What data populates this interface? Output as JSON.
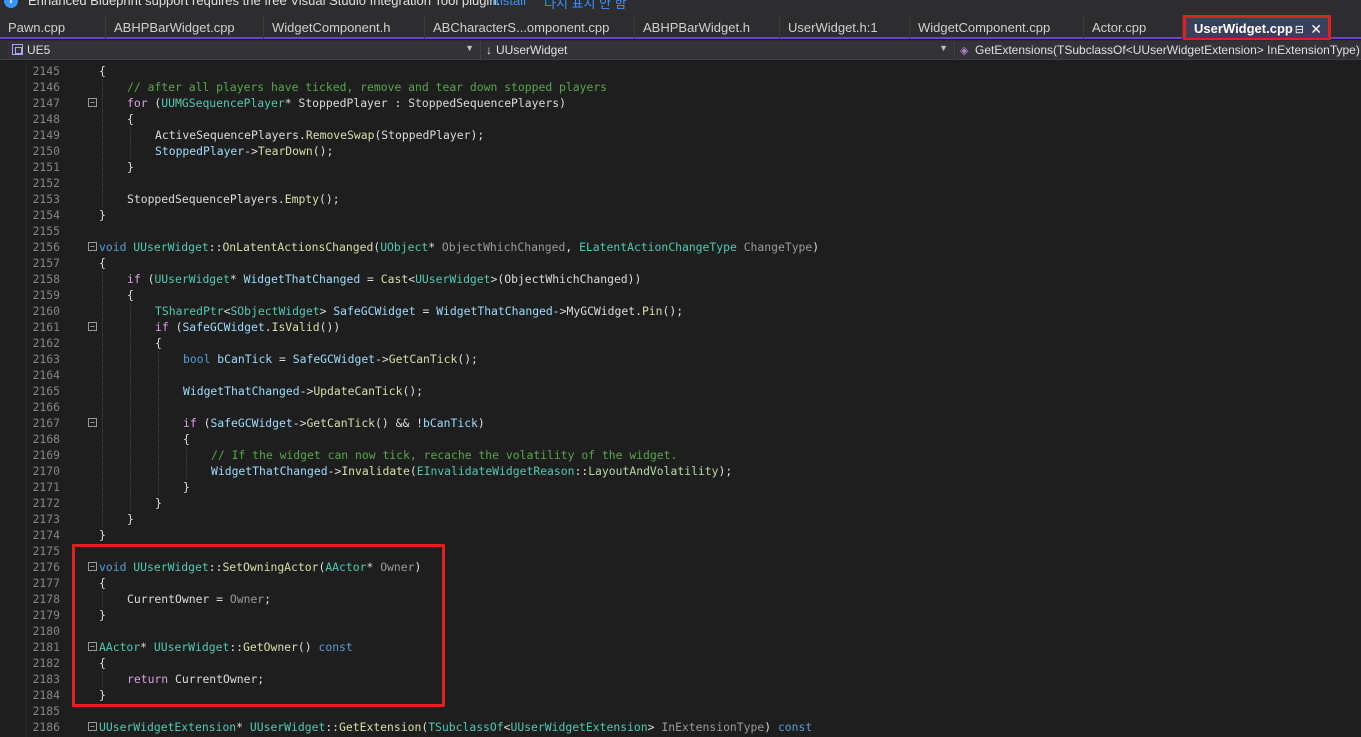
{
  "infobar": {
    "text": "Enhanced Blueprint support requires the free Visual Studio Integration Tool plugin.",
    "link_install": "Install",
    "link_dismiss": "다시 표시 안 함"
  },
  "tabs": [
    {
      "label": "Pawn.cpp",
      "active": false
    },
    {
      "label": "ABHPBarWidget.cpp",
      "active": false
    },
    {
      "label": "WidgetComponent.h",
      "active": false
    },
    {
      "label": "ABCharacterS...omponent.cpp",
      "active": false
    },
    {
      "label": "ABHPBarWidget.h",
      "active": false
    },
    {
      "label": "UserWidget.h:1",
      "active": false
    },
    {
      "label": "WidgetComponent.cpp",
      "active": false
    },
    {
      "label": "Actor.cpp",
      "active": false
    },
    {
      "label": "UserWidget.cpp",
      "active": true
    }
  ],
  "navbar": {
    "project": "UE5",
    "scope": "UUserWidget",
    "member": "GetExtensions(TSubclassOf<UUserWidgetExtension> InExtensionType) c"
  },
  "code_lines": [
    {
      "n": "2145",
      "indent": 1,
      "html": "<span class=\"pl\">{</span>"
    },
    {
      "n": "2146",
      "indent": 2,
      "html": "<span class=\"cm\">// after all players have ticked, remove and tear down stopped players</span>"
    },
    {
      "n": "2147",
      "indent": 2,
      "fold": "-",
      "html": "<span class=\"ctl\">for</span><span class=\"pl\"> (</span><span class=\"ty\">UUMGSequencePlayer</span><span class=\"pl\">* </span><span class=\"pl\">StoppedPlayer : StoppedSequencePlayers)</span>"
    },
    {
      "n": "2148",
      "indent": 2,
      "html": "<span class=\"pl\">{</span>"
    },
    {
      "n": "2149",
      "indent": 3,
      "html": "<span class=\"pl\">ActiveSequencePlayers.</span><span class=\"fn\">RemoveSwap</span><span class=\"pl\">(StoppedPlayer);</span>"
    },
    {
      "n": "2150",
      "indent": 3,
      "html": "<span class=\"var\">StoppedPlayer</span><span class=\"pl\">-></span><span class=\"fn\">TearDown</span><span class=\"pl\">();</span>"
    },
    {
      "n": "2151",
      "indent": 2,
      "html": "<span class=\"pl\">}</span>"
    },
    {
      "n": "2152",
      "indent": 2,
      "html": ""
    },
    {
      "n": "2153",
      "indent": 2,
      "html": "<span class=\"pl\">StoppedSequencePlayers.</span><span class=\"fn\">Empty</span><span class=\"pl\">();</span>"
    },
    {
      "n": "2154",
      "indent": 1,
      "html": "<span class=\"pl\">}</span>"
    },
    {
      "n": "2155",
      "indent": 0,
      "html": ""
    },
    {
      "n": "2156",
      "indent": 0,
      "fold": "-",
      "html": "<span class=\"kw\">void</span><span class=\"pl\"> </span><span class=\"ty\">UUserWidget</span><span class=\"pl\">::</span><span class=\"fn\">OnLatentActionsChanged</span><span class=\"pl\">(</span><span class=\"ty\">UObject</span><span class=\"pl\">* </span><span class=\"par\">ObjectWhichChanged</span><span class=\"pl\">, </span><span class=\"ty\">ELatentActionChangeType</span><span class=\"pl\"> </span><span class=\"par\">ChangeType</span><span class=\"pl\">)</span>"
    },
    {
      "n": "2157",
      "indent": 1,
      "html": "<span class=\"pl\">{</span>"
    },
    {
      "n": "2158",
      "indent": 2,
      "html": "<span class=\"ctl\">if</span><span class=\"pl\"> (</span><span class=\"ty\">UUserWidget</span><span class=\"pl\">* </span><span class=\"var\">WidgetThatChanged</span><span class=\"pl\"> = </span><span class=\"fn\">Cast</span><span class=\"pl\">&lt;</span><span class=\"ty\">UUserWidget</span><span class=\"pl\">&gt;(ObjectWhichChanged))</span>"
    },
    {
      "n": "2159",
      "indent": 2,
      "html": "<span class=\"pl\">{</span>"
    },
    {
      "n": "2160",
      "indent": 3,
      "html": "<span class=\"ty\">TSharedPtr</span><span class=\"pl\">&lt;</span><span class=\"ty\">SObjectWidget</span><span class=\"pl\">&gt; </span><span class=\"var\">SafeGCWidget</span><span class=\"pl\"> = </span><span class=\"var\">WidgetThatChanged</span><span class=\"pl\">->MyGCWidget.</span><span class=\"fn\">Pin</span><span class=\"pl\">();</span>"
    },
    {
      "n": "2161",
      "indent": 3,
      "fold": "-",
      "html": "<span class=\"ctl\">if</span><span class=\"pl\"> (</span><span class=\"var\">SafeGCWidget</span><span class=\"pl\">.</span><span class=\"fn\">IsValid</span><span class=\"pl\">())</span>"
    },
    {
      "n": "2162",
      "indent": 3,
      "html": "<span class=\"pl\">{</span>"
    },
    {
      "n": "2163",
      "indent": 4,
      "html": "<span class=\"kw\">bool</span><span class=\"pl\"> </span><span class=\"var\">bCanTick</span><span class=\"pl\"> = </span><span class=\"var\">SafeGCWidget</span><span class=\"pl\">-></span><span class=\"fn\">GetCanTick</span><span class=\"pl\">();</span>"
    },
    {
      "n": "2164",
      "indent": 4,
      "html": ""
    },
    {
      "n": "2165",
      "indent": 4,
      "html": "<span class=\"var\">WidgetThatChanged</span><span class=\"pl\">-></span><span class=\"fn\">UpdateCanTick</span><span class=\"pl\">();</span>"
    },
    {
      "n": "2166",
      "indent": 4,
      "html": ""
    },
    {
      "n": "2167",
      "indent": 4,
      "fold": "-",
      "html": "<span class=\"ctl\">if</span><span class=\"pl\"> (</span><span class=\"var\">SafeGCWidget</span><span class=\"pl\">-></span><span class=\"fn\">GetCanTick</span><span class=\"pl\">() &amp;&amp; !</span><span class=\"var\">bCanTick</span><span class=\"pl\">)</span>"
    },
    {
      "n": "2168",
      "indent": 4,
      "html": "<span class=\"pl\">{</span>"
    },
    {
      "n": "2169",
      "indent": 5,
      "html": "<span class=\"cm\">// If the widget can now tick, recache the volatility of the widget.</span>"
    },
    {
      "n": "2170",
      "indent": 5,
      "html": "<span class=\"var\">WidgetThatChanged</span><span class=\"pl\">-></span><span class=\"fn\">Invalidate</span><span class=\"pl\">(</span><span class=\"ty\">EInvalidateWidgetReason</span><span class=\"pl\">::</span><span class=\"en\">LayoutAndVolatility</span><span class=\"pl\">);</span>"
    },
    {
      "n": "2171",
      "indent": 4,
      "html": "<span class=\"pl\">}</span>"
    },
    {
      "n": "2172",
      "indent": 3,
      "html": "<span class=\"pl\">}</span>"
    },
    {
      "n": "2173",
      "indent": 2,
      "html": "<span class=\"pl\">}</span>"
    },
    {
      "n": "2174",
      "indent": 1,
      "html": "<span class=\"pl\">}</span>"
    },
    {
      "n": "2175",
      "indent": 0,
      "html": ""
    },
    {
      "n": "2176",
      "indent": 0,
      "fold": "-",
      "html": "<span class=\"kw\">void</span><span class=\"pl\"> </span><span class=\"ty\">UUserWidget</span><span class=\"pl\">::</span><span class=\"fn\">SetOwningActor</span><span class=\"pl\">(</span><span class=\"ty\">AActor</span><span class=\"pl\">* </span><span class=\"par\">Owner</span><span class=\"pl\">)</span>"
    },
    {
      "n": "2177",
      "indent": 1,
      "html": "<span class=\"pl\">{</span>"
    },
    {
      "n": "2178",
      "indent": 2,
      "html": "<span class=\"pl\">CurrentOwner = </span><span class=\"par\">Owner</span><span class=\"pl\">;</span>"
    },
    {
      "n": "2179",
      "indent": 1,
      "html": "<span class=\"pl\">}</span>"
    },
    {
      "n": "2180",
      "indent": 0,
      "html": ""
    },
    {
      "n": "2181",
      "indent": 0,
      "fold": "-",
      "html": "<span class=\"ty\">AActor</span><span class=\"pl\">* </span><span class=\"ty\">UUserWidget</span><span class=\"pl\">::</span><span class=\"fn\">GetOwner</span><span class=\"pl\">() </span><span class=\"kw\">const</span>"
    },
    {
      "n": "2182",
      "indent": 1,
      "html": "<span class=\"pl\">{</span>"
    },
    {
      "n": "2183",
      "indent": 2,
      "html": "<span class=\"ctl\">return</span><span class=\"pl\"> CurrentOwner;</span>"
    },
    {
      "n": "2184",
      "indent": 1,
      "html": "<span class=\"pl\">}</span>"
    },
    {
      "n": "2185",
      "indent": 0,
      "html": ""
    },
    {
      "n": "2186",
      "indent": 0,
      "fold": "-",
      "html": "<span class=\"ty\">UUserWidgetExtension</span><span class=\"pl\">* </span><span class=\"ty\">UUserWidget</span><span class=\"pl\">::</span><span class=\"fn\">GetExtension</span><span class=\"pl\">(</span><span class=\"ty\">TSubclassOf</span><span class=\"pl\">&lt;</span><span class=\"ty\">UUserWidgetExtension</span><span class=\"pl\">&gt; </span><span class=\"par\">InExtensionType</span><span class=\"pl\">) </span><span class=\"kw\">const</span>"
    },
    {
      "n": "2187",
      "indent": 1,
      "html": "<span class=\"pl\">{</span>"
    }
  ],
  "colors": {
    "accent": "#6c44c8",
    "highlight_box": "#e02020",
    "editor_bg": "#1e1e1e"
  }
}
